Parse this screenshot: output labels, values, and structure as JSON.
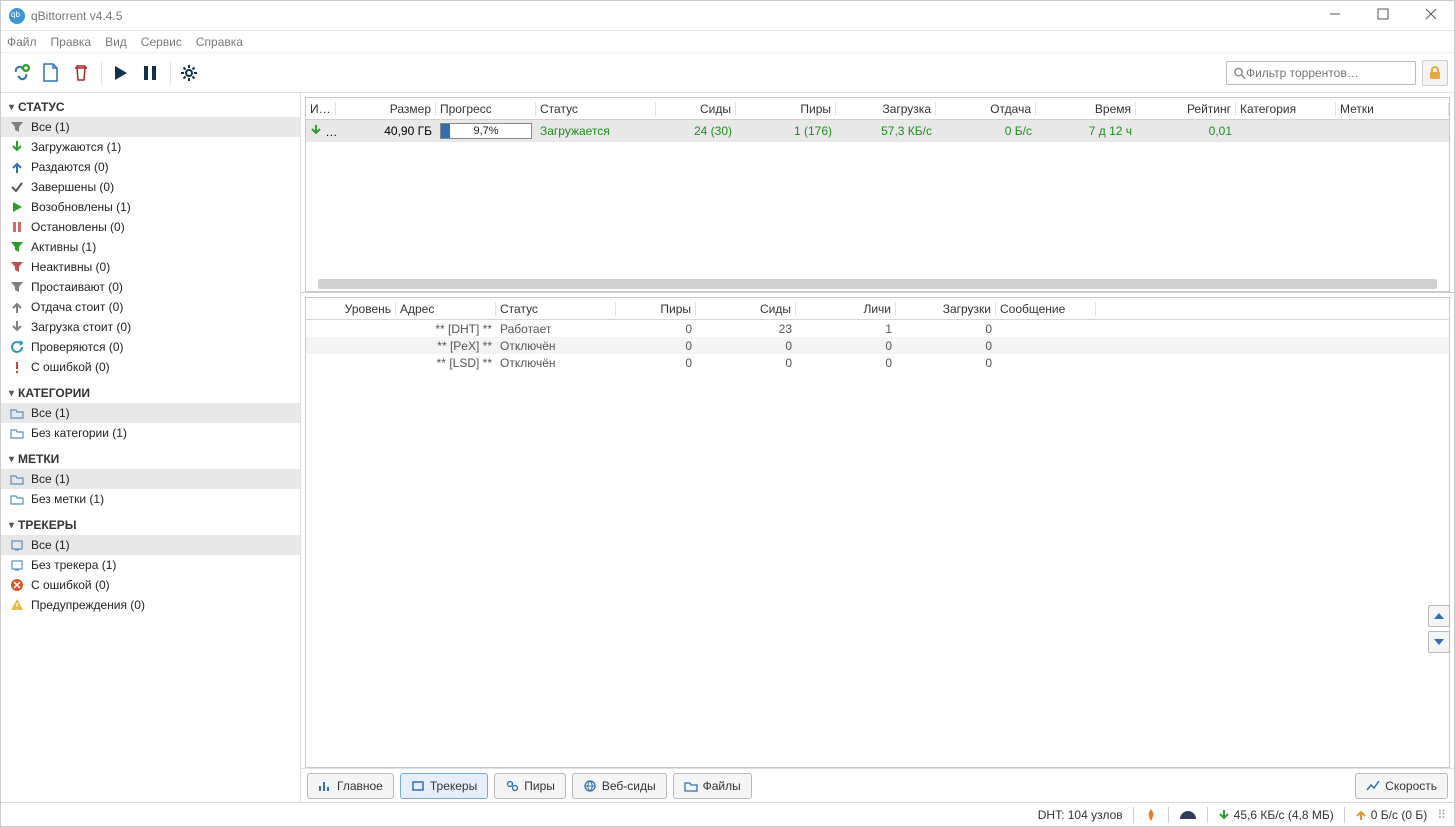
{
  "window": {
    "title": "qBittorrent v4.4.5"
  },
  "menu": [
    "Файл",
    "Правка",
    "Вид",
    "Сервис",
    "Справка"
  ],
  "search": {
    "placeholder": "Фильтр торрентов…"
  },
  "sidebar": {
    "status": {
      "header": "СТАТУС",
      "items": [
        {
          "label": "Все (1)"
        },
        {
          "label": "Загружаются (1)"
        },
        {
          "label": "Раздаются (0)"
        },
        {
          "label": "Завершены (0)"
        },
        {
          "label": "Возобновлены (1)"
        },
        {
          "label": "Остановлены (0)"
        },
        {
          "label": "Активны (1)"
        },
        {
          "label": "Неактивны (0)"
        },
        {
          "label": "Простаивают (0)"
        },
        {
          "label": "Отдача стоит (0)"
        },
        {
          "label": "Загрузка стоит (0)"
        },
        {
          "label": "Проверяются (0)"
        },
        {
          "label": "С ошибкой (0)"
        }
      ]
    },
    "categories": {
      "header": "КАТЕГОРИИ",
      "items": [
        {
          "label": "Все (1)"
        },
        {
          "label": "Без категории (1)"
        }
      ]
    },
    "tags": {
      "header": "МЕТКИ",
      "items": [
        {
          "label": "Все (1)"
        },
        {
          "label": "Без метки (1)"
        }
      ]
    },
    "trackers": {
      "header": "ТРЕКЕРЫ",
      "items": [
        {
          "label": "Все (1)"
        },
        {
          "label": "Без трекера (1)"
        },
        {
          "label": "С ошибкой (0)"
        },
        {
          "label": "Предупреждения (0)"
        }
      ]
    }
  },
  "torrents": {
    "cols": [
      "И…",
      "Размер",
      "Прогресс",
      "Статус",
      "Сиды",
      "Пиры",
      "Загрузка",
      "Отдача",
      "Время",
      "Рейтинг",
      "Категория",
      "Метки"
    ],
    "row": {
      "name": "…",
      "size": "40,90 ГБ",
      "progress": "9,7%",
      "progress_pct": 9.7,
      "status": "Загружается",
      "seeds": "24 (30)",
      "peers": "1 (176)",
      "dl": "57,3 КБ/с",
      "ul": "0 Б/с",
      "eta": "7 д 12 ч",
      "ratio": "0,01",
      "category": "",
      "tags": ""
    }
  },
  "trackerTable": {
    "cols": [
      "Уровень",
      "Адрес",
      "Статус",
      "Пиры",
      "Сиды",
      "Личи",
      "Загрузки",
      "Сообщение"
    ],
    "rows": [
      {
        "addr": "** [DHT] **",
        "status": "Работает",
        "peers": "0",
        "seeds": "23",
        "leech": "1",
        "dl": "0",
        "msg": ""
      },
      {
        "addr": "** [PeX] **",
        "status": "Отключён",
        "peers": "0",
        "seeds": "0",
        "leech": "0",
        "dl": "0",
        "msg": ""
      },
      {
        "addr": "** [LSD] **",
        "status": "Отключён",
        "peers": "0",
        "seeds": "0",
        "leech": "0",
        "dl": "0",
        "msg": ""
      }
    ]
  },
  "tabs": {
    "main": "Главное",
    "trackers": "Трекеры",
    "peers": "Пиры",
    "webseeds": "Веб-сиды",
    "files": "Файлы",
    "speed": "Скорость"
  },
  "statusbar": {
    "dht": "DHT: 104 узлов",
    "down": "45,6 КБ/с (4,8 МБ)",
    "up": "0 Б/с (0 Б)"
  }
}
